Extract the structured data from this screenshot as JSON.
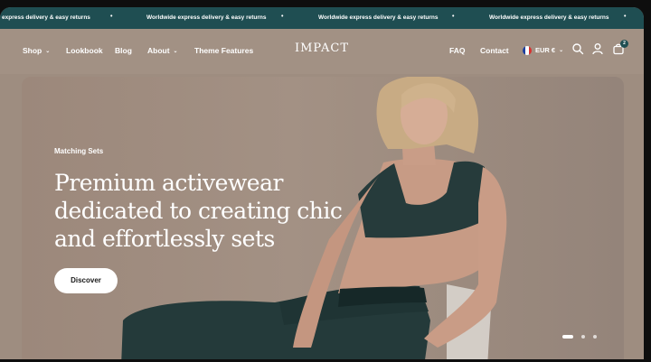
{
  "announcement": {
    "items": [
      "express delivery & easy returns",
      "Worldwide express delivery & easy returns",
      "Worldwide express delivery & easy returns",
      "Worldwide express delivery & easy returns"
    ],
    "separator": "•"
  },
  "header": {
    "nav_left": [
      "Shop",
      "Lookbook",
      "Blog",
      "About",
      "Theme Features"
    ],
    "logo": "IMPACT",
    "nav_right": [
      "FAQ",
      "Contact"
    ],
    "currency": "EUR €",
    "cart_count": "2"
  },
  "hero": {
    "eyebrow": "Matching Sets",
    "headline": "Premium activewear dedicated to creating chic and effortlessly sets",
    "cta": "Discover",
    "slides": 3,
    "active_slide": 1
  },
  "colors": {
    "announcement_bg": "#1f4e52",
    "hero_bg": "#a39184",
    "text": "#ffffff"
  },
  "icons": [
    "chevron-down-icon",
    "france-flag-icon",
    "search-icon",
    "user-icon",
    "cart-icon"
  ]
}
